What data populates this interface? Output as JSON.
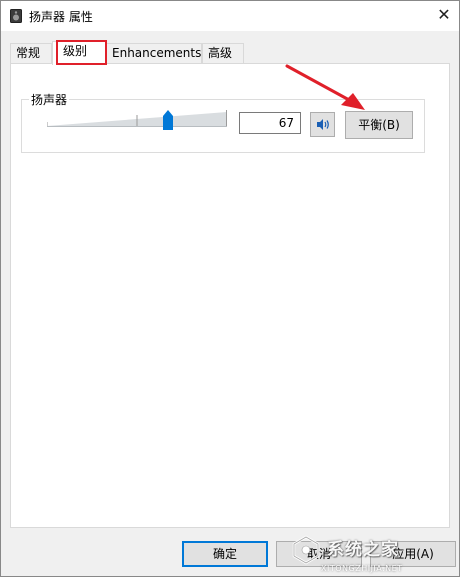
{
  "window": {
    "title": "扬声器 属性",
    "close_glyph": "✕"
  },
  "tabs": [
    {
      "label": "常规",
      "selected": false
    },
    {
      "label": "级别",
      "selected": true
    },
    {
      "label": "Enhancements",
      "selected": false
    },
    {
      "label": "高级",
      "selected": false
    }
  ],
  "level_group": {
    "label": "扬声器",
    "volume": 67,
    "volume_text": "67",
    "balance_label": "平衡(B)"
  },
  "footer": {
    "ok_label": "确定",
    "cancel_label": "取消",
    "apply_label": "应用(A)"
  },
  "watermark": {
    "logo_text": "系统之家",
    "logo_url": "XITONGZHIJIA.NET"
  },
  "colors": {
    "accent": "#0078d7",
    "annotation_red": "#e0202a"
  },
  "icons": {
    "title": "speaker-device-icon",
    "mute": "speaker-volume-icon",
    "close": "close-icon"
  }
}
